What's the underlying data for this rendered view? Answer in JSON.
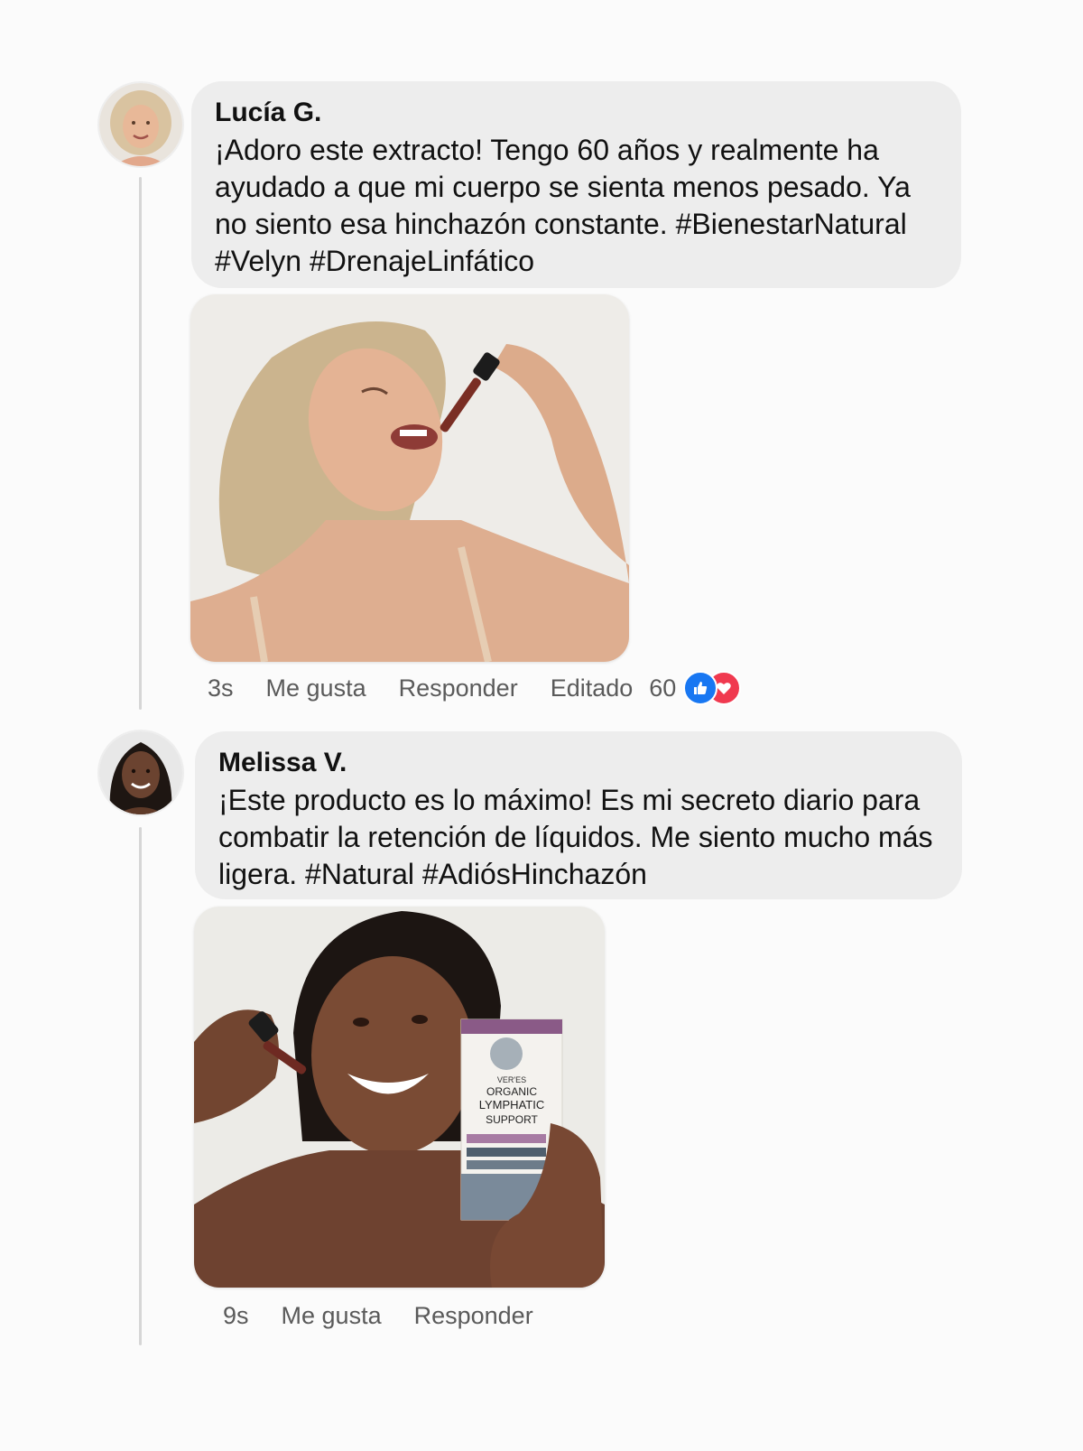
{
  "comments": [
    {
      "author": "Lucía G.",
      "text": "¡Adoro este extracto! Tengo 60 años y realmente ha ayudado a que mi cuerpo se sienta menos pesado. Ya no siento esa hinchazón constante. #BienestarNatural #Velyn #DrenajeLinfático",
      "time": "3s",
      "like_label": "Me gusta",
      "reply_label": "Responder",
      "edited_label": "Editado",
      "reaction_count": "60",
      "reactions": [
        "like-icon",
        "heart-icon"
      ]
    },
    {
      "author": "Melissa V.",
      "text": "¡Este producto es lo máximo! Es mi secreto diario para combatir la retención de líquidos. Me siento mucho más ligera. #Natural #AdiósHinchazón",
      "time": "9s",
      "like_label": "Me gusta",
      "reply_label": "Responder"
    }
  ],
  "product_box": {
    "brand": "VER'ES",
    "line1": "ORGANIC",
    "line2": "LYMPHATIC",
    "line3": "SUPPORT"
  },
  "colors": {
    "like_blue": "#1877f2",
    "heart_red": "#f0394f",
    "bubble_bg": "#ededed"
  }
}
